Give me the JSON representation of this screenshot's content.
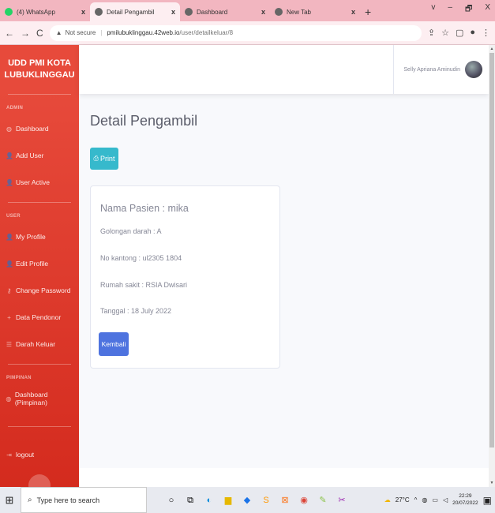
{
  "browser": {
    "tabs": [
      {
        "title": "(4) WhatsApp",
        "icon": "whatsapp-icon",
        "color": "#25d366",
        "active": false
      },
      {
        "title": "Detail Pengambil",
        "icon": "globe-icon",
        "color": "#555555",
        "active": true
      },
      {
        "title": "Dashboard",
        "icon": "globe-icon",
        "color": "#555555",
        "active": false
      },
      {
        "title": "New Tab",
        "icon": "chrome-icon",
        "color": "#555555",
        "active": false
      }
    ],
    "tab_close": "x",
    "new_tab": "+",
    "window_controls": [
      "v",
      "–",
      "🗗",
      "X"
    ],
    "not_secure": "Not secure",
    "url_host": "pmilubuklinggau.42web.io",
    "url_path": "/user/detailkeluar/8"
  },
  "sidebar": {
    "brand": "UDD PMI KOTA LUBUKLINGGAU",
    "headings": {
      "admin": "ADMIN",
      "user": "USER",
      "pimpinan": "PIMPINAN"
    },
    "admin_items": [
      {
        "label": "Dashboard",
        "icon": "tachometer-icon",
        "glyph": "◍"
      },
      {
        "label": "Add User",
        "icon": "user-plus-icon",
        "glyph": "👤"
      },
      {
        "label": "User Active",
        "icon": "user-check-icon",
        "glyph": "👤"
      }
    ],
    "user_items": [
      {
        "label": "My Profile",
        "icon": "user-icon",
        "glyph": "👤"
      },
      {
        "label": "Edit Profile",
        "icon": "user-edit-icon",
        "glyph": "👤"
      },
      {
        "label": "Change Password",
        "icon": "key-icon",
        "glyph": "⚷"
      },
      {
        "label": "Data Pendonor",
        "icon": "plus-icon",
        "glyph": "+"
      },
      {
        "label": "Darah Keluar",
        "icon": "list-icon",
        "glyph": "☰"
      }
    ],
    "pimpinan_items": [
      {
        "label": "Dashboard (Pimpinan)",
        "icon": "tachometer-icon",
        "glyph": "◍"
      }
    ],
    "logout": {
      "label": "logout",
      "icon": "sign-out-icon",
      "glyph": "⇥"
    }
  },
  "topbar": {
    "user_name": "Selly Apriana Aminudin"
  },
  "main": {
    "page_title": "Detail Pengambil",
    "print_label": "Print",
    "card": {
      "nama_pasien": "Nama Pasien : mika",
      "golongan_darah": "Golongan darah : A",
      "no_kantong": "No kantong : ul2305 1804",
      "rumah_sakit": "Rumah sakit : RSIA Dwisari",
      "tanggal": "Tanggal : 18 July 2022",
      "back_label": "Kembali"
    }
  },
  "taskbar": {
    "search_placeholder": "Type here to search",
    "temperature": "27°C",
    "time": "22:29",
    "date": "20/07/2022"
  },
  "colors": {
    "sidebar": "#e74a3b",
    "print_button": "#36b9cc",
    "back_button": "#4e73df",
    "tab_bar": "#f2b6c0"
  }
}
